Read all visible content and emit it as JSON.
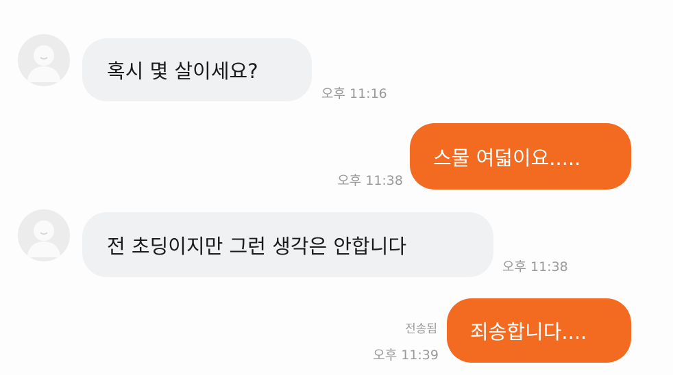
{
  "messages": [
    {
      "direction": "incoming",
      "text": "혹시 몇 살이세요?",
      "time": "오후 11:16",
      "avatar_icon": "person-silhouette"
    },
    {
      "direction": "outgoing",
      "text": "스물 여덟이요.....",
      "time": "오후 11:38"
    },
    {
      "direction": "incoming",
      "text": "전 초딩이지만 그런 생각은 안합니다",
      "time": "오후 11:38",
      "avatar_icon": "person-silhouette"
    },
    {
      "direction": "outgoing",
      "text": "죄송합니다....",
      "time": "오후 11:39",
      "status": "전송됨"
    }
  ],
  "colors": {
    "outgoing_bubble": "#f26b21",
    "incoming_bubble": "#f0f1f3",
    "timestamp": "#9a9a9a"
  }
}
